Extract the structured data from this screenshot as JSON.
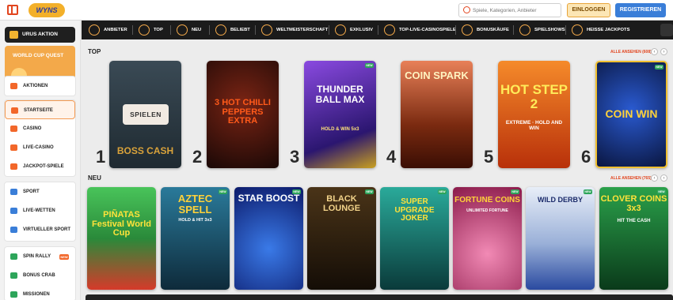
{
  "header": {
    "logo_text": "WYNS",
    "search_placeholder": "Spiele, Kategorien, Anbieter",
    "login_label": "EINLOGGEN",
    "register_label": "REGISTRIEREN"
  },
  "sidebar": {
    "promo_action": "URUS AKTION",
    "promo_quest": "WORLD CUP QUEST",
    "group1": [
      {
        "label": "AKTIONEN",
        "icon": "gift-icon"
      }
    ],
    "group2": [
      {
        "label": "STARTSEITE",
        "icon": "home-icon",
        "active": true
      },
      {
        "label": "CASINO",
        "icon": "slot-icon"
      },
      {
        "label": "LIVE-CASINO",
        "icon": "cards-icon"
      },
      {
        "label": "JACKPOT-SPIELE",
        "icon": "jackpot-icon"
      }
    ],
    "group3": [
      {
        "label": "SPORT",
        "icon": "ball-icon"
      },
      {
        "label": "LIVE-WETTEN",
        "icon": "live-icon"
      },
      {
        "label": "VIRTUELLER SPORT",
        "icon": "virtual-icon"
      }
    ],
    "group4": [
      {
        "label": "SPIN RALLY",
        "icon": "rally-icon",
        "badge": "NEW"
      },
      {
        "label": "BONUS CRAB",
        "icon": "crab-icon"
      },
      {
        "label": "MISSIONEN",
        "icon": "mission-icon"
      }
    ]
  },
  "categories": [
    {
      "label": "ANBIETER",
      "icon": "providers-icon"
    },
    {
      "label": "TOP",
      "icon": "crown-icon"
    },
    {
      "label": "NEU",
      "icon": "lightning-icon"
    },
    {
      "label": "BELIEBT",
      "icon": "fire-icon"
    },
    {
      "label": "WELTMEISTERSCHAFT",
      "icon": "trophy-icon"
    },
    {
      "label": "EXKLUSIV",
      "icon": "diamond-icon"
    },
    {
      "label": "TOP-LIVE-CASINOSPIELE",
      "icon": "star-icon"
    },
    {
      "label": "BONUSKÄUFE",
      "icon": "bonus-icon"
    },
    {
      "label": "SPIELSHOWS",
      "icon": "microphone-icon"
    },
    {
      "label": "HEISSE JACKPOTS",
      "icon": "pot-icon"
    }
  ],
  "top": {
    "title": "TOP",
    "see_all": "ALLE ANSEHEN (608)",
    "games": [
      {
        "rank": "1",
        "name": "BOSS CASH",
        "play_label": "SPIELEN",
        "colors": [
          "#3a4a55",
          "#1f2a31"
        ]
      },
      {
        "rank": "2",
        "name": "3 HOT CHILLI PEPPERS EXTRA",
        "colors": [
          "#5a1a10",
          "#1a0806"
        ]
      },
      {
        "rank": "3",
        "name": "THUNDER BALL MAX",
        "sub": "HOLD & WIN 5x3",
        "badge": "NEW",
        "colors": [
          "#7a3fd0",
          "#2b1670"
        ]
      },
      {
        "rank": "4",
        "name": "COIN SPARK",
        "colors": [
          "#e0623a",
          "#5a1c0a"
        ]
      },
      {
        "rank": "5",
        "name": "HOT STEP 2",
        "sub": "EXTREME · HOLD AND WIN",
        "colors": [
          "#f06a1a",
          "#a82a08"
        ]
      },
      {
        "rank": "6",
        "name": "COIN WIN",
        "badge": "NEW",
        "colors": [
          "#1a3a8a",
          "#0a1640"
        ]
      }
    ]
  },
  "neu": {
    "title": "NEU",
    "see_all": "ALLE ANSEHEN (765)",
    "games": [
      {
        "name": "PIÑATAS Festival World Cup",
        "colors": [
          "#3bb24a",
          "#d63a2a"
        ]
      },
      {
        "name": "AZTEC SPELL",
        "sub": "HOLD & HIT 3x3",
        "badge": "NEW",
        "colors": [
          "#2a6a8a",
          "#0e2a3a"
        ]
      },
      {
        "name": "STAR BOOST",
        "badge": "NEW",
        "colors": [
          "#2a5ad8",
          "#0c1a6a"
        ]
      },
      {
        "name": "BLACK LOUNGE",
        "badge": "NEW",
        "colors": [
          "#3a2a12",
          "#140d06"
        ]
      },
      {
        "name": "SUPER UPGRADE JOKER",
        "badge": "NEW",
        "colors": [
          "#2a9a9a",
          "#0a3a3a"
        ]
      },
      {
        "name": "FORTUNE COINS",
        "sub": "UNLIMITED FORTUNE",
        "badge": "NEW",
        "colors": [
          "#e84a8a",
          "#8a1a4a"
        ]
      },
      {
        "name": "WILD DERBY",
        "badge": "NEW",
        "colors": [
          "#f4f4f4",
          "#2a4aa0"
        ]
      },
      {
        "name": "CLOVER COINS 3x3",
        "sub": "HIT THE CASH",
        "badge": "NEW",
        "colors": [
          "#1a8a3a",
          "#0a3a1a"
        ]
      }
    ]
  }
}
